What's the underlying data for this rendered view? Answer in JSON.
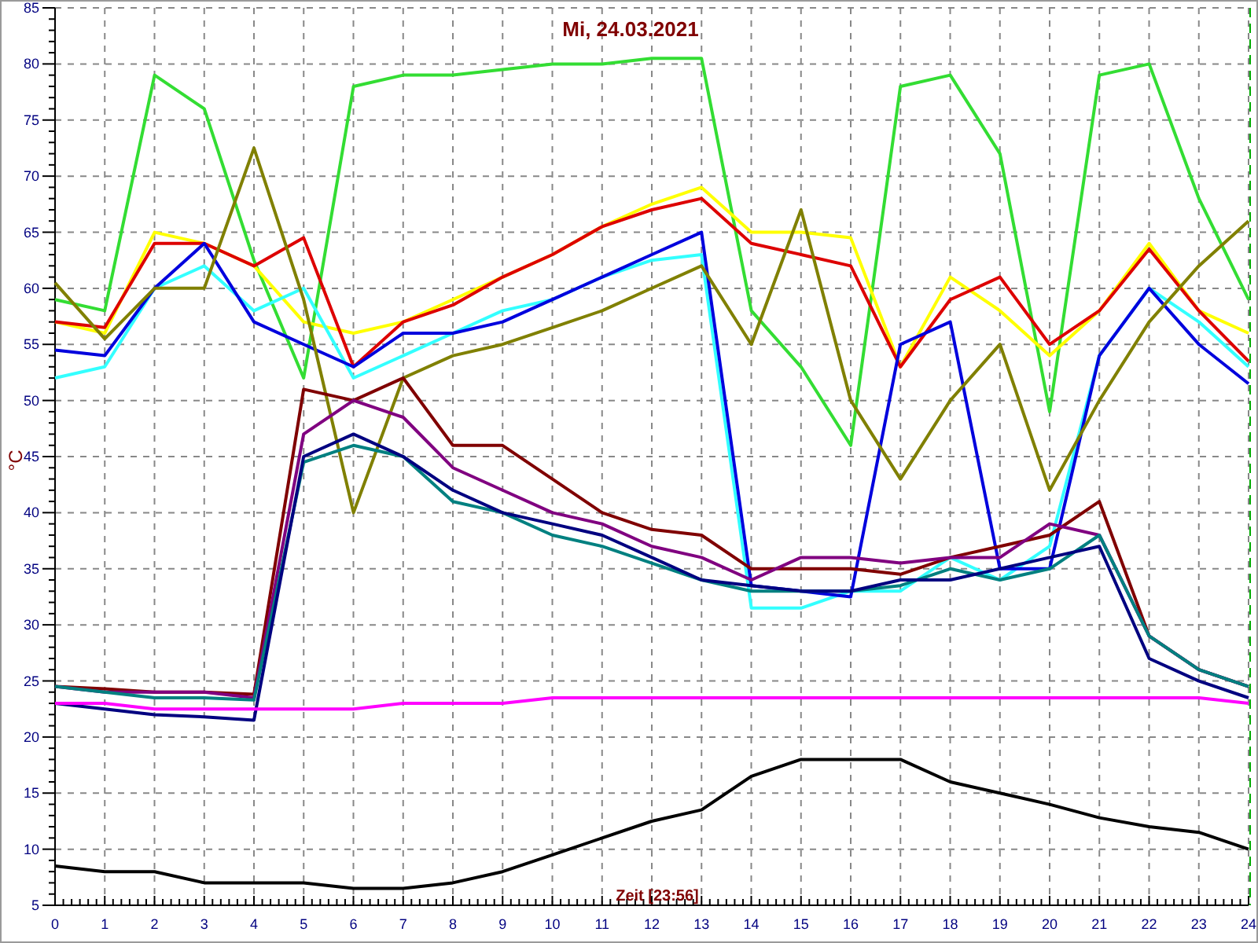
{
  "chart_data": {
    "type": "line",
    "title": "Mi, 24.03.2021",
    "xlabel": "Zeit [23:56]",
    "ylabel": "°C",
    "x": [
      0,
      1,
      2,
      3,
      4,
      5,
      6,
      7,
      8,
      9,
      10,
      11,
      12,
      13,
      14,
      15,
      16,
      17,
      18,
      19,
      20,
      21,
      22,
      23,
      24
    ],
    "xlim": [
      0,
      24
    ],
    "grid": true,
    "ylim": [
      5,
      85
    ],
    "xticks": [
      0,
      1,
      2,
      3,
      4,
      5,
      6,
      7,
      8,
      9,
      10,
      11,
      12,
      13,
      14,
      15,
      16,
      17,
      18,
      19,
      20,
      21,
      22,
      23,
      24
    ],
    "yticks": [
      5,
      10,
      15,
      20,
      25,
      30,
      35,
      40,
      45,
      50,
      55,
      60,
      65,
      70,
      75,
      80,
      85
    ],
    "series": [
      {
        "color": "#33dd33",
        "values": [
          59,
          58,
          79,
          76,
          62.5,
          52,
          78,
          79,
          79,
          79.5,
          80,
          80,
          80.5,
          80.5,
          58,
          53,
          46,
          78,
          79,
          72,
          49,
          79,
          80,
          68,
          59
        ]
      },
      {
        "color": "#ffff00",
        "values": [
          57,
          56,
          65,
          64,
          62,
          57,
          56,
          57,
          59,
          61,
          63,
          65.5,
          67.5,
          69,
          65,
          65,
          64.5,
          53,
          61,
          58,
          54,
          58,
          64,
          58,
          56
        ]
      },
      {
        "color": "#dd0000",
        "values": [
          57,
          56.5,
          64,
          64,
          62,
          64.5,
          53,
          57,
          58.5,
          61,
          63,
          65.5,
          67,
          68,
          64,
          63,
          62,
          53,
          59,
          61,
          55,
          58,
          63.5,
          58,
          53.5
        ]
      },
      {
        "color": "#33ffff",
        "values": [
          52,
          53,
          60,
          62,
          58,
          60,
          52,
          54,
          56,
          58,
          59,
          61,
          62.5,
          63,
          31.5,
          31.5,
          33,
          33,
          36,
          34,
          37,
          54,
          60,
          57,
          53
        ]
      },
      {
        "color": "#0000dd",
        "values": [
          54.5,
          54,
          60,
          64,
          57,
          55,
          53,
          56,
          56,
          57,
          59,
          61,
          63,
          65,
          33.5,
          33,
          32.5,
          55,
          57,
          35,
          35,
          54,
          60,
          55,
          51.5
        ]
      },
      {
        "color": "#808000",
        "values": [
          60.5,
          55.5,
          60,
          60,
          72.5,
          59,
          40,
          52,
          54,
          55,
          56.5,
          58,
          60,
          62,
          55,
          67,
          50,
          43,
          50,
          55,
          42,
          50,
          57,
          62,
          66
        ]
      },
      {
        "color": "#800000",
        "values": [
          24.5,
          24.3,
          24,
          24,
          23.8,
          51,
          50,
          52,
          46,
          46,
          43,
          40,
          38.5,
          38,
          35,
          35,
          35,
          34.5,
          36,
          37,
          38,
          41,
          29,
          26,
          24.5
        ]
      },
      {
        "color": "#800080",
        "values": [
          24.5,
          24,
          24,
          24,
          23.5,
          47,
          50,
          48.5,
          44,
          42,
          40,
          39,
          37,
          36,
          34,
          36,
          36,
          35.5,
          36,
          36,
          39,
          38,
          29,
          26,
          24.5
        ]
      },
      {
        "color": "#008080",
        "values": [
          24.5,
          24,
          23.5,
          23.5,
          23.3,
          44.5,
          46,
          45,
          41,
          40,
          38,
          37,
          35.5,
          34,
          33,
          33,
          33,
          33.5,
          35,
          34,
          35,
          38,
          29,
          26,
          24.5
        ]
      },
      {
        "color": "#000080",
        "values": [
          23,
          22.5,
          22,
          21.8,
          21.5,
          45,
          47,
          45,
          42,
          40,
          39,
          38,
          36,
          34,
          33.5,
          33,
          33,
          34,
          34,
          35,
          36,
          37,
          27,
          25,
          23.5
        ]
      },
      {
        "color": "#ff00ff",
        "values": [
          23,
          23,
          22.5,
          22.5,
          22.5,
          22.5,
          22.5,
          23,
          23,
          23,
          23.5,
          23.5,
          23.5,
          23.5,
          23.5,
          23.5,
          23.5,
          23.5,
          23.5,
          23.5,
          23.5,
          23.5,
          23.5,
          23.5,
          23
        ]
      },
      {
        "color": "#000000",
        "values": [
          8.5,
          8,
          8,
          7,
          7,
          7,
          6.5,
          6.5,
          7,
          8,
          9.5,
          11,
          12.5,
          13.5,
          16.5,
          18,
          18,
          18,
          16,
          15,
          14,
          12.8,
          12,
          11.5,
          10
        ]
      }
    ]
  }
}
